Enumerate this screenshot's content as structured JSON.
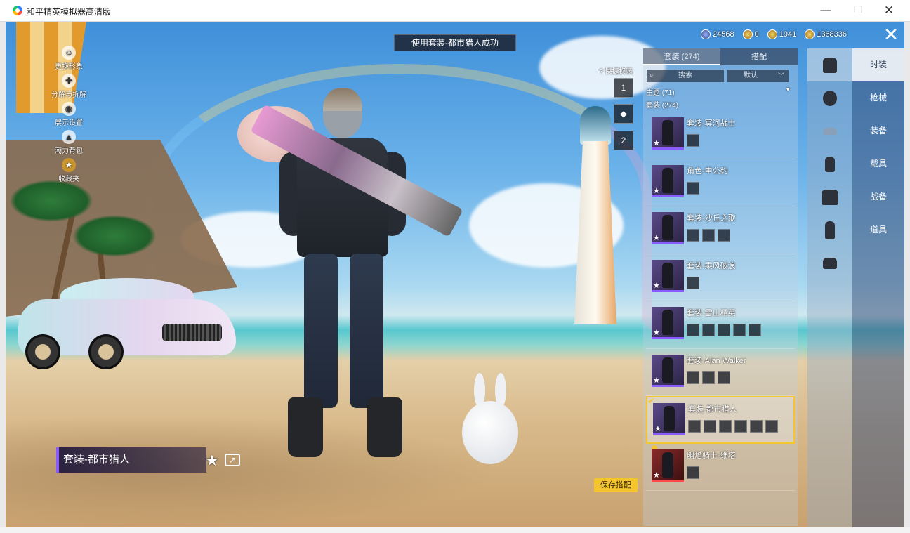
{
  "window": {
    "title": "和平精英模拟器高清版",
    "minimize": "—",
    "maximize": "☐",
    "close": "✕"
  },
  "toast": "使用套装-都市猎人成功",
  "left_menu": [
    {
      "label": "更换形象",
      "icon": "avatar-icon"
    },
    {
      "label": "分解与拆解",
      "icon": "dismantle-icon"
    },
    {
      "label": "展示设置",
      "icon": "eye-icon"
    },
    {
      "label": "潮力背包",
      "icon": "backpack-icon"
    },
    {
      "label": "收藏夹",
      "icon": "badge-icon"
    }
  ],
  "current_outfit": "套装-都市猎人",
  "quick_swap": {
    "label": "快捷换装",
    "slots": [
      "1",
      "",
      "2"
    ]
  },
  "save_label": "保存搭配",
  "currency": [
    {
      "value": "24568",
      "icon": "ticket-icon"
    },
    {
      "value": "0",
      "icon": "coin-icon"
    },
    {
      "value": "1941",
      "icon": "coupon-icon"
    },
    {
      "value": "1368336",
      "icon": "gold-icon"
    }
  ],
  "panel": {
    "tabs": [
      {
        "label": "套装 (274)",
        "active": true
      },
      {
        "label": "搭配",
        "active": false
      }
    ],
    "search_placeholder": "搜索",
    "sort_label": "默认",
    "theme_filter": "主题 (71)",
    "section_count": "套装 (274)",
    "items": [
      {
        "name": "套装-冥河战士",
        "parts": 1,
        "selected": false,
        "rarity": "purple"
      },
      {
        "name": "角色-申公豹",
        "parts": 1,
        "selected": false,
        "rarity": "purple"
      },
      {
        "name": "套装-沙丘之歌",
        "parts": 3,
        "selected": false,
        "rarity": "purple"
      },
      {
        "name": "套装-乘风破浪",
        "parts": 1,
        "selected": false,
        "rarity": "purple"
      },
      {
        "name": "套装-雪山精英",
        "parts": 5,
        "selected": false,
        "rarity": "purple"
      },
      {
        "name": "套装-Alan Walker",
        "parts": 3,
        "selected": false,
        "rarity": "purple"
      },
      {
        "name": "套装-都市猎人",
        "parts": 6,
        "selected": true,
        "rarity": "purple"
      },
      {
        "name": "幽焰骑士-维塔",
        "parts": 1,
        "selected": false,
        "rarity": "red"
      }
    ]
  },
  "categories": [
    {
      "label": "时装",
      "icon": "outfit-icon",
      "active": true
    },
    {
      "label": "枪械",
      "icon": "helmet-icon",
      "active": false
    },
    {
      "label": "装备",
      "icon": "goggles-icon",
      "active": false
    },
    {
      "label": "载具",
      "icon": "mask-icon",
      "active": false
    },
    {
      "label": "战备",
      "icon": "jacket-icon",
      "active": false
    },
    {
      "label": "道具",
      "icon": "pants-icon",
      "active": false
    },
    {
      "label": "",
      "icon": "boots-icon",
      "active": false
    }
  ]
}
